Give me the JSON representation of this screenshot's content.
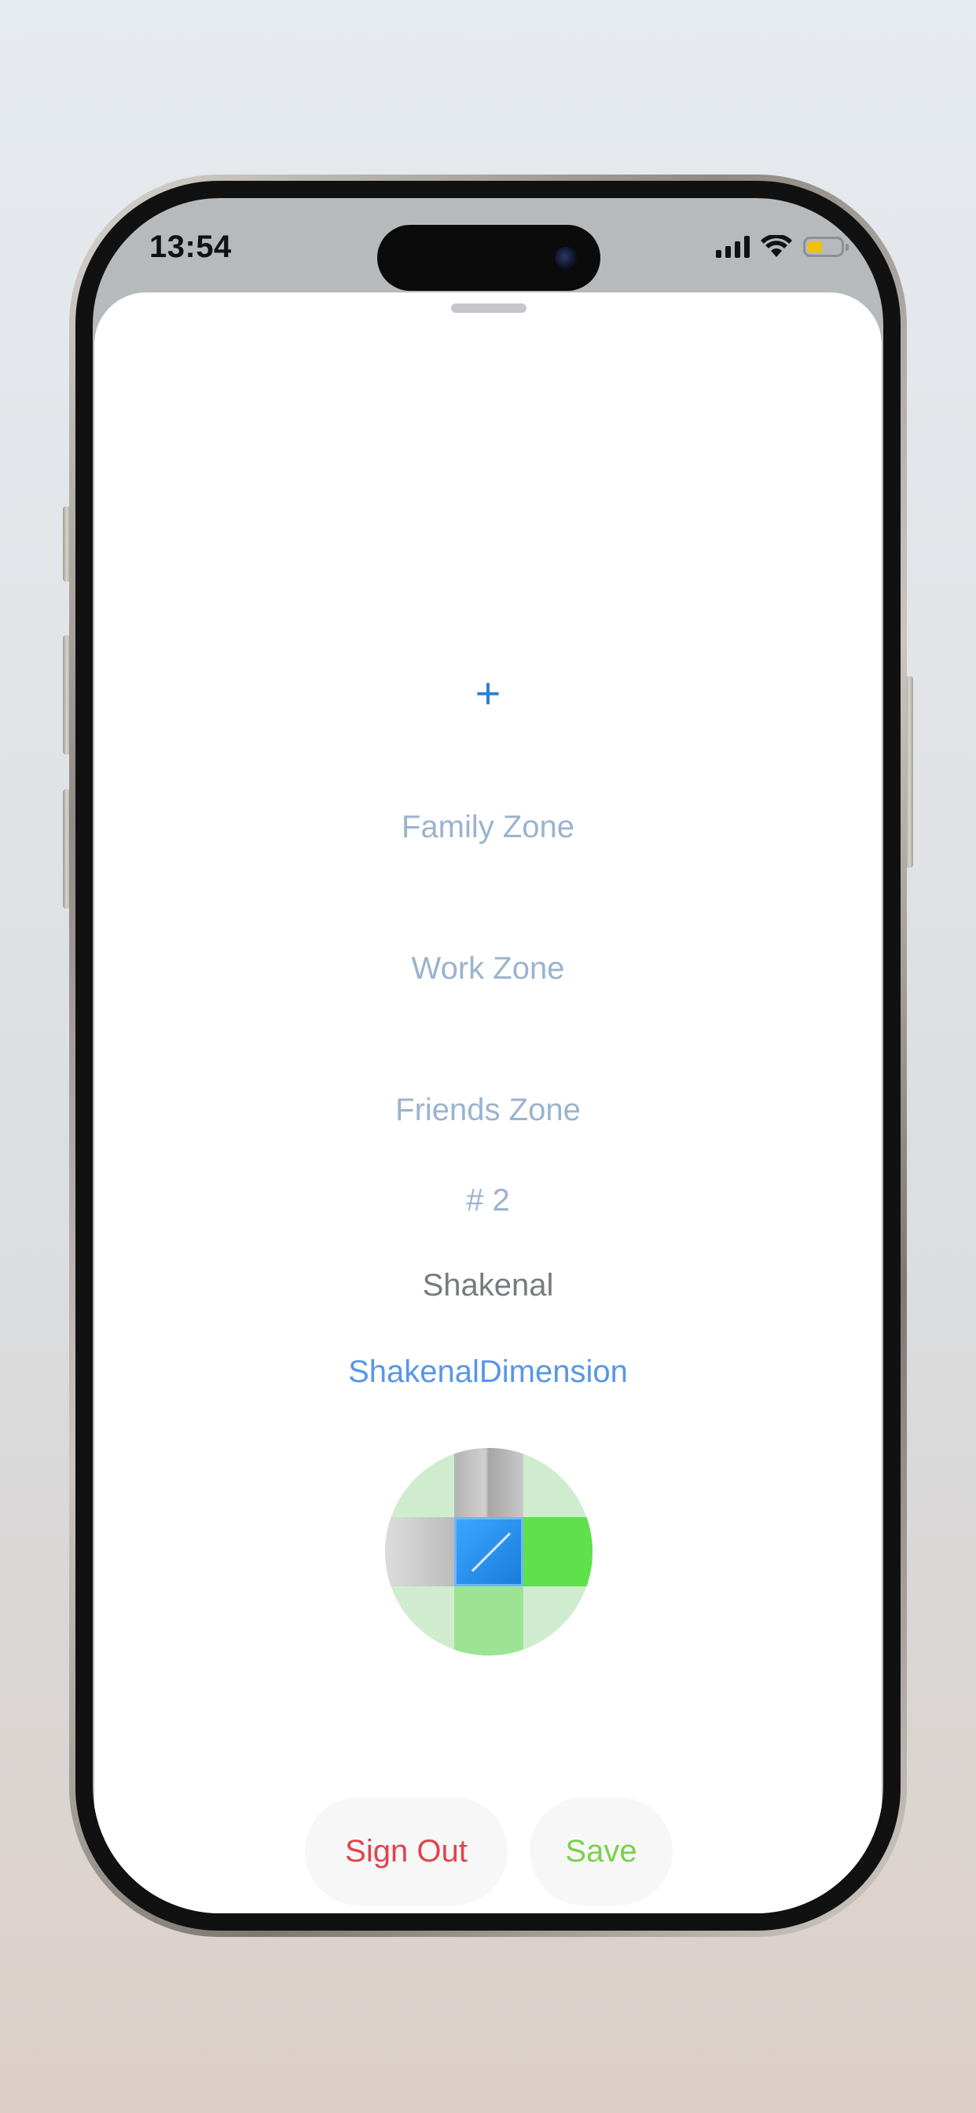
{
  "status_bar": {
    "time": "13:54",
    "signal_icon": "cellular-signal-icon",
    "wifi_icon": "wifi-icon",
    "battery_icon": "battery-icon",
    "battery_level": 0.45,
    "battery_color": "#f2c200"
  },
  "sheet": {
    "add_label": "+",
    "zones": [
      "Family Zone",
      "Work Zone",
      "Friends Zone"
    ],
    "number_label": "# 2",
    "username": "Shakenal",
    "dimension_name": "ShakenalDimension",
    "colors": {
      "accent_blue": "#2f80d6",
      "zone_text": "#9ab3cf",
      "dimension_text": "#5796e8",
      "sign_out": "#e0444c",
      "save": "#7ad14a"
    }
  },
  "dpad": {
    "icon": "dimension-dpad-icon",
    "cells": {
      "top": "gray",
      "left": "gray",
      "center": "blue",
      "right": "green",
      "bottom": "light-green"
    }
  },
  "buttons": {
    "sign_out": "Sign Out",
    "save": "Save"
  }
}
